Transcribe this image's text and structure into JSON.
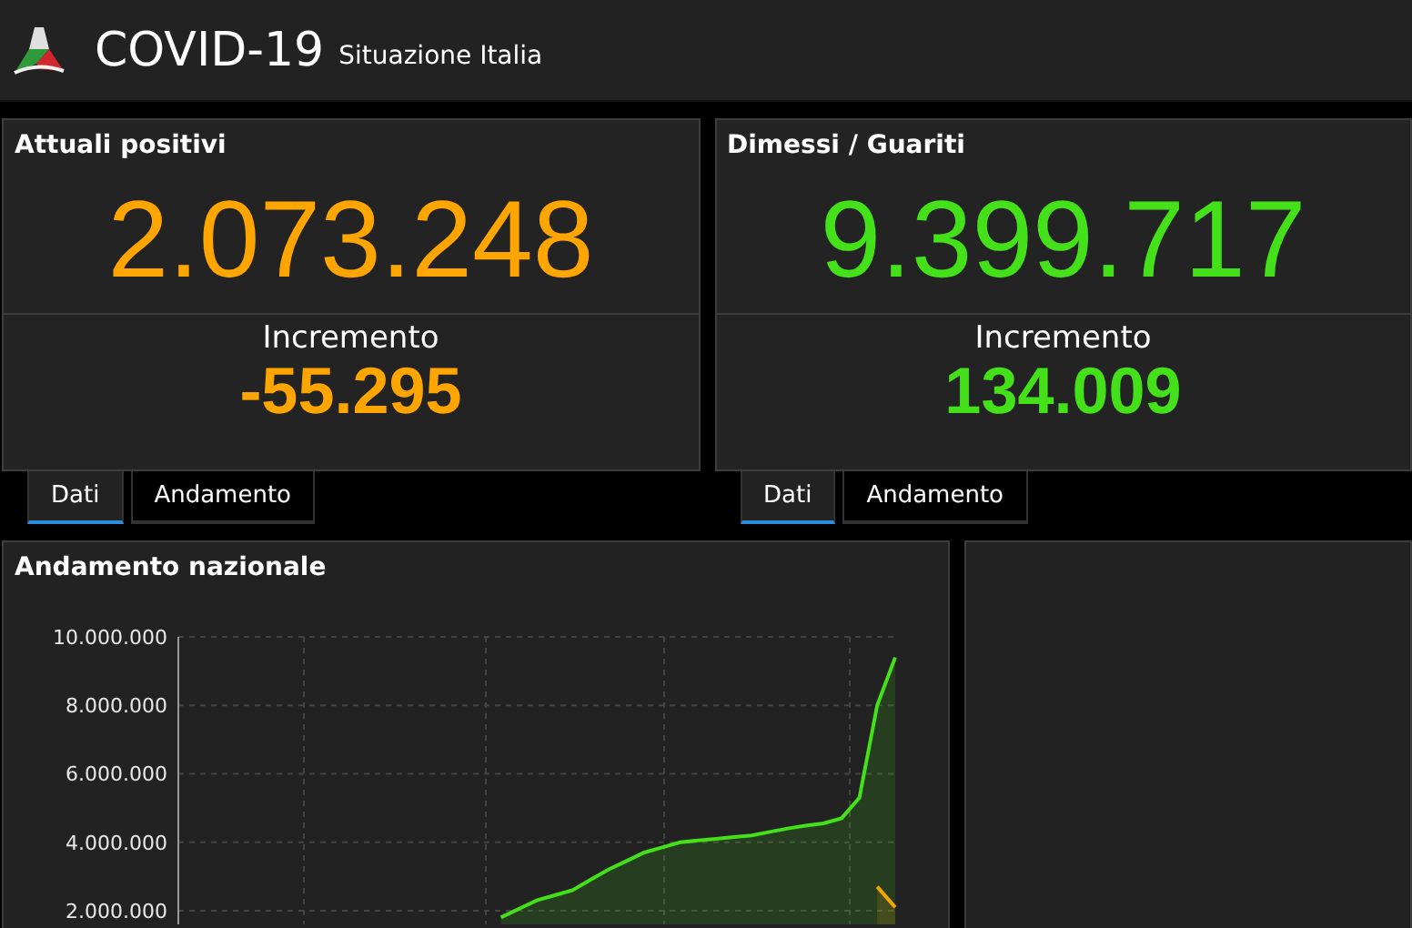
{
  "header": {
    "title": "COVID-19",
    "subtitle": "Situazione Italia"
  },
  "cards": [
    {
      "title": "Attuali positivi",
      "value": "2.073.248",
      "delta_label": "Incremento",
      "delta": "-55.295",
      "color": "#ffa500",
      "tabs": [
        {
          "label": "Dati",
          "selected": true
        },
        {
          "label": "Andamento",
          "selected": false
        }
      ]
    },
    {
      "title": "Dimessi / Guariti",
      "value": "9.399.717",
      "delta_label": "Incremento",
      "delta": "134.009",
      "color": "#44e01a",
      "tabs": [
        {
          "label": "Dati",
          "selected": true
        },
        {
          "label": "Andamento",
          "selected": false
        }
      ]
    }
  ],
  "trend_panel": {
    "title": "Andamento nazionale",
    "chart_data": {
      "type": "area",
      "grid": true,
      "categories": [
        null,
        null,
        null,
        null,
        null,
        null,
        null,
        null,
        null,
        null,
        null,
        null,
        null,
        null,
        null,
        null,
        null,
        null,
        null,
        null,
        null,
        null,
        null,
        null,
        null,
        null,
        null,
        null,
        null,
        null,
        null,
        null,
        null,
        null,
        null,
        null,
        null,
        null,
        null,
        null,
        null
      ],
      "series": [
        {
          "color": "#44e01a",
          "values": [
            null,
            null,
            null,
            null,
            null,
            null,
            null,
            null,
            null,
            null,
            null,
            null,
            null,
            null,
            null,
            null,
            null,
            null,
            1800000,
            2050000,
            2300000,
            2450000,
            2600000,
            2900000,
            3200000,
            3450000,
            3700000,
            3850000,
            4000000,
            4050000,
            4100000,
            4150000,
            4200000,
            4300000,
            4400000,
            4480000,
            4550000,
            4700000,
            5300000,
            8000000,
            9400000
          ]
        },
        {
          "color": "#f0a800",
          "values": [
            null,
            null,
            null,
            null,
            null,
            null,
            null,
            null,
            null,
            null,
            null,
            null,
            null,
            null,
            null,
            null,
            null,
            null,
            null,
            null,
            null,
            null,
            null,
            null,
            null,
            null,
            null,
            null,
            null,
            null,
            null,
            null,
            null,
            null,
            null,
            null,
            null,
            null,
            null,
            2700000,
            2100000
          ]
        }
      ],
      "ylim": [
        1600000,
        10000000
      ],
      "yticks": [
        {
          "value": 2000000,
          "label": "2.000.000"
        },
        {
          "value": 4000000,
          "label": "4.000.000"
        },
        {
          "value": 6000000,
          "label": "6.000.000"
        },
        {
          "value": 8000000,
          "label": "8.000.000"
        },
        {
          "value": 10000000,
          "label": "10.000.000"
        }
      ]
    }
  }
}
